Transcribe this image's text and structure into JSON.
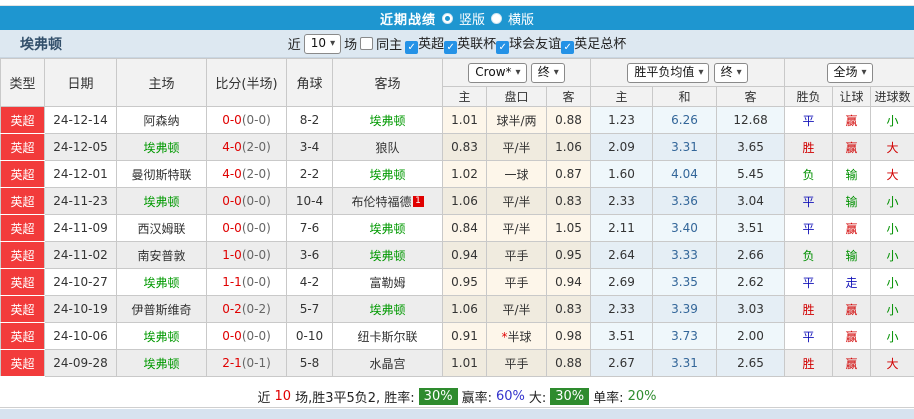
{
  "title_bar": {
    "title": "近期战绩",
    "radio_vertical_label": "竖版",
    "radio_horizontal_label": "横版"
  },
  "filter": {
    "team": "埃弗顿",
    "near_label": "近",
    "count_select": "10",
    "matches_label": "场",
    "same_home_label": "同主",
    "leagues": [
      "英超",
      "英联杯",
      "球会友谊",
      "英足总杯"
    ]
  },
  "dropdowns": {
    "company": "Crow*",
    "handicap_time": "终",
    "odds_type": "胜平负均值",
    "odds_time": "终",
    "scope": "全场"
  },
  "table": {
    "headers_main": [
      "类型",
      "日期",
      "主场",
      "比分(半场)",
      "角球",
      "客场"
    ],
    "headers_sub": [
      "主",
      "盘口",
      "客",
      "主",
      "和",
      "客",
      "胜负",
      "让球",
      "进球数"
    ],
    "rows": [
      {
        "league": "英超",
        "date": "24-12-14",
        "home": "阿森纳",
        "home_self": false,
        "score": "0-0",
        "half": "(0-0)",
        "corner": "8-2",
        "away": "埃弗顿",
        "away_self": true,
        "away_badge": "",
        "ah_home": "1.01",
        "handicap": "球半/两",
        "handicap_star": false,
        "ah_away": "0.88",
        "odds_home": "1.23",
        "odds_draw": "6.26",
        "odds_away": "12.68",
        "result": "平",
        "result_c": "draw",
        "let_ball": "赢",
        "let_c": "win",
        "goals": "小",
        "goals_c": "small"
      },
      {
        "league": "英超",
        "date": "24-12-05",
        "home": "埃弗顿",
        "home_self": true,
        "score": "4-0",
        "half": "(2-0)",
        "corner": "3-4",
        "away": "狼队",
        "away_self": false,
        "away_badge": "",
        "ah_home": "0.83",
        "handicap": "平/半",
        "handicap_star": false,
        "ah_away": "1.06",
        "odds_home": "2.09",
        "odds_draw": "3.31",
        "odds_away": "3.65",
        "result": "胜",
        "result_c": "win",
        "let_ball": "赢",
        "let_c": "win",
        "goals": "大",
        "goals_c": "big"
      },
      {
        "league": "英超",
        "date": "24-12-01",
        "home": "曼彻斯特联",
        "home_self": false,
        "score": "4-0",
        "half": "(2-0)",
        "corner": "2-2",
        "away": "埃弗顿",
        "away_self": true,
        "away_badge": "",
        "ah_home": "1.02",
        "handicap": "一球",
        "handicap_star": false,
        "ah_away": "0.87",
        "odds_home": "1.60",
        "odds_draw": "4.04",
        "odds_away": "5.45",
        "result": "负",
        "result_c": "lose",
        "let_ball": "输",
        "let_c": "lose",
        "goals": "大",
        "goals_c": "big"
      },
      {
        "league": "英超",
        "date": "24-11-23",
        "home": "埃弗顿",
        "home_self": true,
        "score": "0-0",
        "half": "(0-0)",
        "corner": "10-4",
        "away": "布伦特福德",
        "away_self": false,
        "away_badge": "1",
        "ah_home": "1.06",
        "handicap": "平/半",
        "handicap_star": false,
        "ah_away": "0.83",
        "odds_home": "2.33",
        "odds_draw": "3.36",
        "odds_away": "3.04",
        "result": "平",
        "result_c": "draw",
        "let_ball": "输",
        "let_c": "lose",
        "goals": "小",
        "goals_c": "small"
      },
      {
        "league": "英超",
        "date": "24-11-09",
        "home": "西汉姆联",
        "home_self": false,
        "score": "0-0",
        "half": "(0-0)",
        "corner": "7-6",
        "away": "埃弗顿",
        "away_self": true,
        "away_badge": "",
        "ah_home": "0.84",
        "handicap": "平/半",
        "handicap_star": false,
        "ah_away": "1.05",
        "odds_home": "2.11",
        "odds_draw": "3.40",
        "odds_away": "3.51",
        "result": "平",
        "result_c": "draw",
        "let_ball": "赢",
        "let_c": "win",
        "goals": "小",
        "goals_c": "small"
      },
      {
        "league": "英超",
        "date": "24-11-02",
        "home": "南安普敦",
        "home_self": false,
        "score": "1-0",
        "half": "(0-0)",
        "corner": "3-6",
        "away": "埃弗顿",
        "away_self": true,
        "away_badge": "",
        "ah_home": "0.94",
        "handicap": "平手",
        "handicap_star": false,
        "ah_away": "0.95",
        "odds_home": "2.64",
        "odds_draw": "3.33",
        "odds_away": "2.66",
        "result": "负",
        "result_c": "lose",
        "let_ball": "输",
        "let_c": "lose",
        "goals": "小",
        "goals_c": "small"
      },
      {
        "league": "英超",
        "date": "24-10-27",
        "home": "埃弗顿",
        "home_self": true,
        "score": "1-1",
        "half": "(0-0)",
        "corner": "4-2",
        "away": "富勒姆",
        "away_self": false,
        "away_badge": "",
        "ah_home": "0.95",
        "handicap": "平手",
        "handicap_star": false,
        "ah_away": "0.94",
        "odds_home": "2.69",
        "odds_draw": "3.35",
        "odds_away": "2.62",
        "result": "平",
        "result_c": "draw",
        "let_ball": "走",
        "let_c": "push",
        "goals": "小",
        "goals_c": "small"
      },
      {
        "league": "英超",
        "date": "24-10-19",
        "home": "伊普斯维奇",
        "home_self": false,
        "score": "0-2",
        "half": "(0-2)",
        "corner": "5-7",
        "away": "埃弗顿",
        "away_self": true,
        "away_badge": "",
        "ah_home": "1.06",
        "handicap": "平/半",
        "handicap_star": false,
        "ah_away": "0.83",
        "odds_home": "2.33",
        "odds_draw": "3.39",
        "odds_away": "3.03",
        "result": "胜",
        "result_c": "win",
        "let_ball": "赢",
        "let_c": "win",
        "goals": "小",
        "goals_c": "small"
      },
      {
        "league": "英超",
        "date": "24-10-06",
        "home": "埃弗顿",
        "home_self": true,
        "score": "0-0",
        "half": "(0-0)",
        "corner": "0-10",
        "away": "纽卡斯尔联",
        "away_self": false,
        "away_badge": "",
        "ah_home": "0.91",
        "handicap": "半球",
        "handicap_star": true,
        "ah_away": "0.98",
        "odds_home": "3.51",
        "odds_draw": "3.73",
        "odds_away": "2.00",
        "result": "平",
        "result_c": "draw",
        "let_ball": "赢",
        "let_c": "win",
        "goals": "小",
        "goals_c": "small"
      },
      {
        "league": "英超",
        "date": "24-09-28",
        "home": "埃弗顿",
        "home_self": true,
        "score": "2-1",
        "half": "(0-1)",
        "corner": "5-8",
        "away": "水晶宫",
        "away_self": false,
        "away_badge": "",
        "ah_home": "1.01",
        "handicap": "平手",
        "handicap_star": false,
        "ah_away": "0.88",
        "odds_home": "2.67",
        "odds_draw": "3.31",
        "odds_away": "2.65",
        "result": "胜",
        "result_c": "win",
        "let_ball": "赢",
        "let_c": "win",
        "goals": "大",
        "goals_c": "big"
      }
    ]
  },
  "summary": {
    "s1": "近",
    "count": "10",
    "s3": "场,胜3平5负2, 胜率:",
    "win_rate": "30%",
    "s4": "赢率:",
    "handicap_rate": "60%",
    "s5": "大:",
    "big_rate": "30%",
    "s6": "单率:",
    "single_rate": "20%"
  },
  "colors": {
    "title_bar_bg": "#1e96d0",
    "league_badge_bg": "#f23b3b",
    "self_team_green": "#009000",
    "win_red": "#d10000",
    "draw_blue": "#1414b8",
    "lose_green": "#009000",
    "rate_badge_green": "#2e8b2e"
  }
}
